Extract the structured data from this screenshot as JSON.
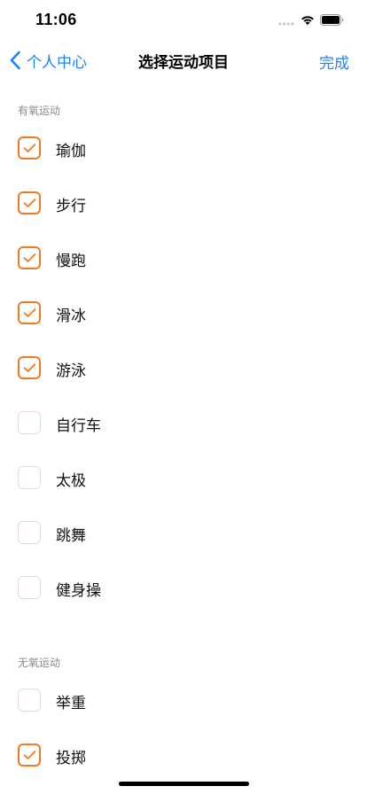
{
  "status_bar": {
    "time": "11:06"
  },
  "nav": {
    "back_label": "个人中心",
    "title": "选择运动项目",
    "done_label": "完成"
  },
  "sections": [
    {
      "header": "有氧运动",
      "items": [
        {
          "label": "瑜伽",
          "checked": true
        },
        {
          "label": "步行",
          "checked": true
        },
        {
          "label": "慢跑",
          "checked": true
        },
        {
          "label": "滑冰",
          "checked": true
        },
        {
          "label": "游泳",
          "checked": true
        },
        {
          "label": "自行车",
          "checked": false
        },
        {
          "label": "太极",
          "checked": false
        },
        {
          "label": "跳舞",
          "checked": false
        },
        {
          "label": "健身操",
          "checked": false
        }
      ]
    },
    {
      "header": "无氧运动",
      "items": [
        {
          "label": "举重",
          "checked": false
        },
        {
          "label": "投掷",
          "checked": true
        }
      ]
    }
  ],
  "colors": {
    "accent": "#1a84ff",
    "check": "#f27a23",
    "unchecked_border": "#ead8dc",
    "section_header": "#8a8a8e"
  }
}
